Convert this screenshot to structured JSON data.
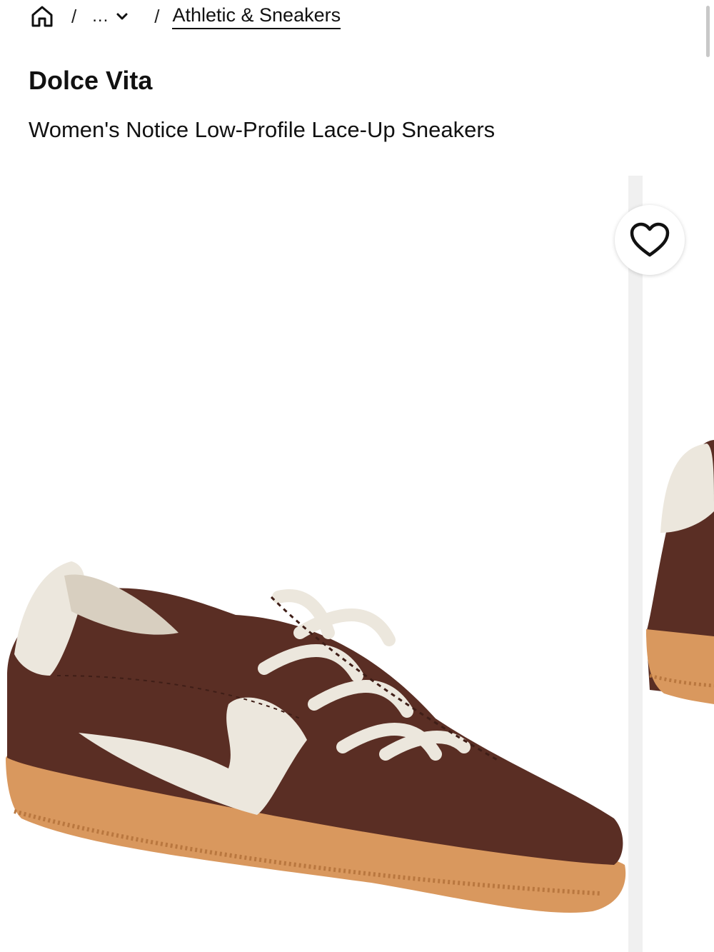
{
  "breadcrumb": {
    "home_icon": "home-icon",
    "separator": "/",
    "more_label": "...",
    "more_icon": "chevron-down-icon",
    "current_label": "Athletic & Sneakers"
  },
  "product": {
    "brand": "Dolce Vita",
    "title": "Women's Notice Low-Profile Lace-Up Sneakers"
  },
  "gallery": {
    "favorite_icon": "heart-icon",
    "colors": {
      "suede": "#5a2e24",
      "accent": "#ece7dd",
      "sole": "#d9985e"
    }
  }
}
